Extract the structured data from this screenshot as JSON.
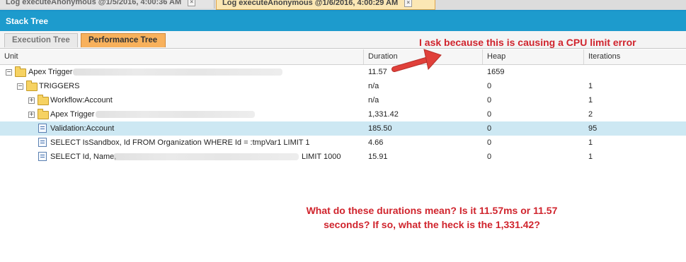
{
  "window_tabs": [
    {
      "label": "Log executeAnonymous @1/5/2016, 4:00:36 AM",
      "active": false
    },
    {
      "label": "Log executeAnonymous @1/6/2016, 4:00:29 AM",
      "active": true
    }
  ],
  "panel": {
    "title": "Stack Tree"
  },
  "subtabs": [
    {
      "label": "Execution Tree",
      "active": false
    },
    {
      "label": "Performance Tree",
      "active": true
    }
  ],
  "columns": {
    "unit": "Unit",
    "duration": "Duration",
    "heap": "Heap",
    "iterations": "Iterations"
  },
  "rows": [
    {
      "unit": "Apex Trigger",
      "duration": "11.57",
      "heap": "1659",
      "iterations": ""
    },
    {
      "unit": "TRIGGERS",
      "duration": "n/a",
      "heap": "0",
      "iterations": "1"
    },
    {
      "unit": "Workflow:Account",
      "duration": "n/a",
      "heap": "0",
      "iterations": "1"
    },
    {
      "unit": "Apex Trigger",
      "duration": "1,331.42",
      "heap": "0",
      "iterations": "2"
    },
    {
      "unit": "Validation:Account",
      "duration": "185.50",
      "heap": "0",
      "iterations": "95",
      "selected": true
    },
    {
      "unit": "SELECT IsSandbox, Id FROM Organization WHERE Id = :tmpVar1 LIMIT 1",
      "duration": "4.66",
      "heap": "0",
      "iterations": "1"
    },
    {
      "unit": "SELECT Id, Name,",
      "unit_suffix": "LIMIT 1000",
      "duration": "15.91",
      "heap": "0",
      "iterations": "1"
    }
  ],
  "annotations": {
    "top": "I ask because this is causing a CPU limit error",
    "bottom_line1": "What do these durations mean? Is it 11.57ms or 11.57",
    "bottom_line2": "seconds? If so, what the heck is the 1,331.42?"
  },
  "colors": {
    "header_blue": "#1d9bcd",
    "active_tab_orange": "#f8b15c",
    "selected_row": "#cde8f3",
    "annotation_red": "#d0242d",
    "arrow_red": "#e0403a"
  },
  "icons": {
    "tree_expand": "plus-box",
    "tree_collapse": "minus-box",
    "folder": "folder-icon",
    "document": "document-icon",
    "close": "close-icon"
  }
}
